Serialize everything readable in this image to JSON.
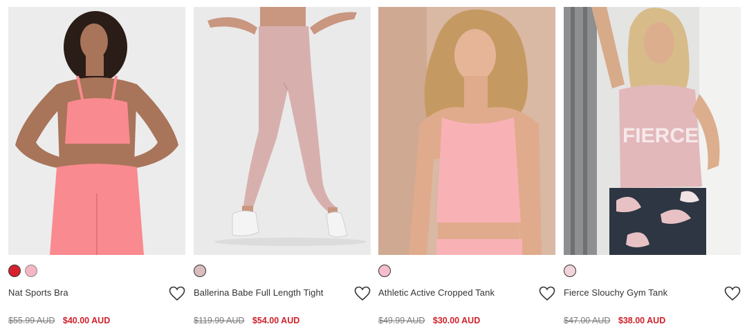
{
  "products": [
    {
      "name": "Nat Sports Bra",
      "swatches": [
        "#d8202e",
        "#f4b6c2"
      ],
      "selected_swatch": 0,
      "original_price": "$55.99 AUD",
      "sale_price": "$40.00 AUD",
      "image_bg": "#ececec",
      "garment_color": "#f98a8f"
    },
    {
      "name": "Ballerina Babe Full Length Tight",
      "swatches": [
        "#d9bcbc"
      ],
      "selected_swatch": 0,
      "original_price": "$119.99 AUD",
      "sale_price": "$54.00 AUD",
      "image_bg": "#eaeaea",
      "garment_color": "#d7b0ad"
    },
    {
      "name": "Athletic Active Cropped Tank",
      "swatches": [
        "#f6bdcc"
      ],
      "selected_swatch": 0,
      "original_price": "$49.99 AUD",
      "sale_price": "$30.00 AUD",
      "image_bg": "#d9b8a4",
      "garment_color": "#f8b2b5"
    },
    {
      "name": "Fierce Slouchy Gym Tank",
      "swatches": [
        "#f1d4d9"
      ],
      "selected_swatch": 0,
      "original_price": "$47.00 AUD",
      "sale_price": "$38.00 AUD",
      "image_bg": "#e4e4e2",
      "garment_color": "#e3b8bb",
      "print_text": "FIERCE"
    }
  ]
}
